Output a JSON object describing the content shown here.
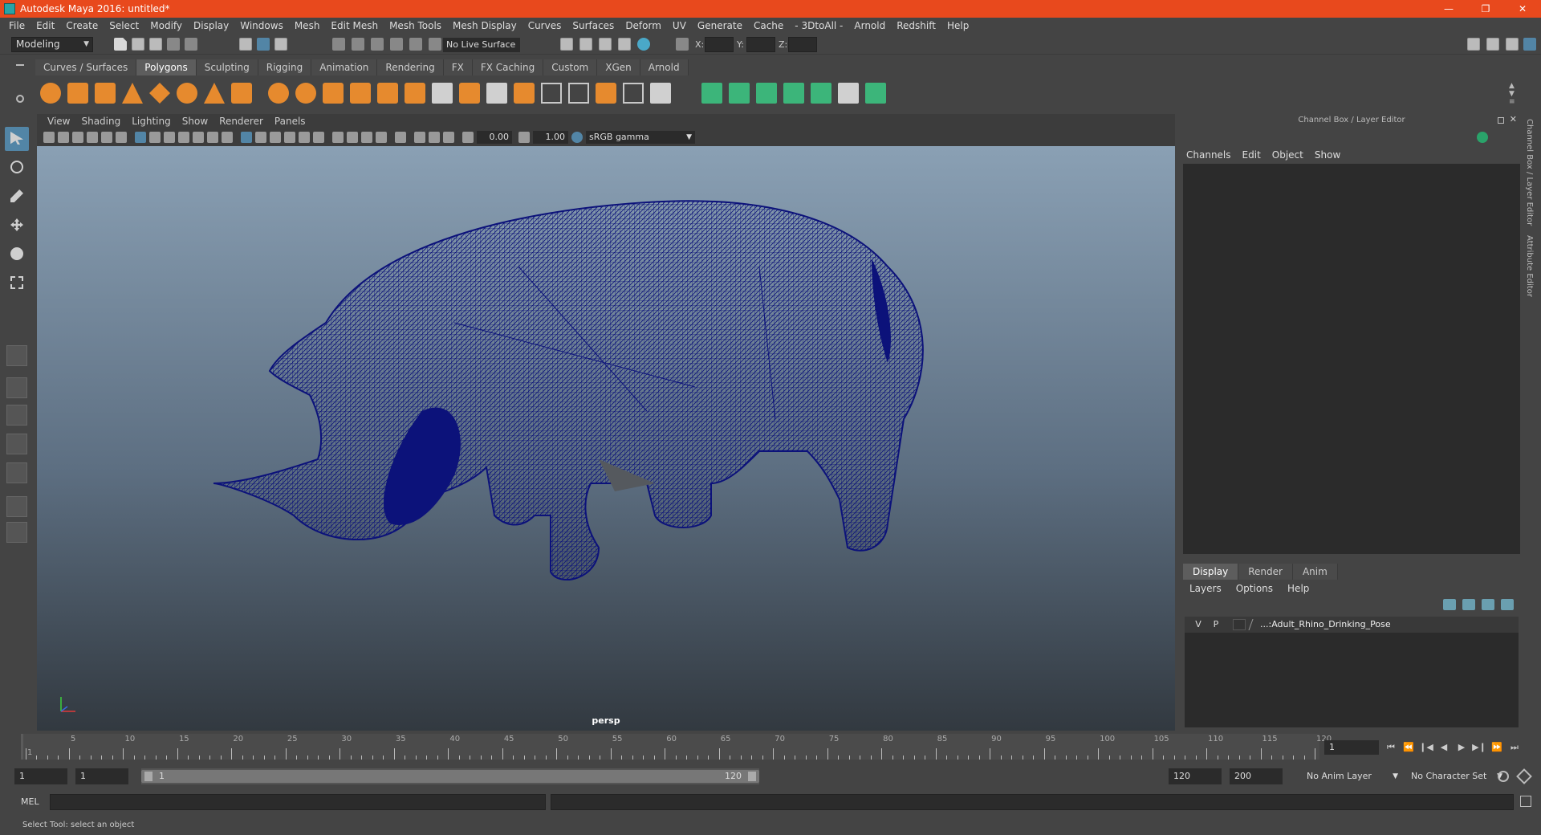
{
  "window": {
    "title": "Autodesk Maya 2016: untitled*",
    "controls": [
      "—",
      "❐",
      "✕"
    ]
  },
  "menubar": [
    "File",
    "Edit",
    "Create",
    "Select",
    "Modify",
    "Display",
    "Windows",
    "Mesh",
    "Edit Mesh",
    "Mesh Tools",
    "Mesh Display",
    "Curves",
    "Surfaces",
    "Deform",
    "UV",
    "Generate",
    "Cache",
    "- 3DtoAll -",
    "Arnold",
    "Redshift",
    "Help"
  ],
  "statusline": {
    "mode": "Modeling",
    "live_surface": "No Live Surface",
    "x_label": "X:",
    "y_label": "Y:",
    "z_label": "Z:"
  },
  "shelf": {
    "tabs": [
      "Curves / Surfaces",
      "Polygons",
      "Sculpting",
      "Rigging",
      "Animation",
      "Rendering",
      "FX",
      "FX Caching",
      "Custom",
      "XGen",
      "Arnold"
    ],
    "active_tab": "Polygons"
  },
  "panel": {
    "menu": [
      "View",
      "Shading",
      "Lighting",
      "Show",
      "Renderer",
      "Panels"
    ],
    "exposure": "0.00",
    "gamma": "1.00",
    "color_space": "sRGB gamma",
    "camera": "persp"
  },
  "channel_box": {
    "title": "Channel Box / Layer Editor",
    "menu": [
      "Channels",
      "Edit",
      "Object",
      "Show"
    ]
  },
  "layer_editor": {
    "tabs": [
      "Display",
      "Render",
      "Anim"
    ],
    "active_tab": "Display",
    "menu": [
      "Layers",
      "Options",
      "Help"
    ],
    "layers": [
      {
        "v": "V",
        "p": "P",
        "name": "...:Adult_Rhino_Drinking_Pose"
      }
    ]
  },
  "side_tabs": [
    "Channel Box / Layer Editor",
    "Attribute Editor"
  ],
  "timeline": {
    "ticks": [
      1,
      5,
      10,
      15,
      20,
      25,
      30,
      35,
      40,
      45,
      50,
      55,
      60,
      65,
      70,
      75,
      80,
      85,
      90,
      95,
      100,
      105,
      110,
      115,
      120
    ],
    "min": 1,
    "max": 120,
    "current_frame": "1"
  },
  "range": {
    "start_field": "1",
    "playback_start": "1",
    "slider_start": "1",
    "slider_end": "120",
    "playback_end": "120",
    "end_field": "200",
    "anim_layer": "No Anim Layer",
    "character_set": "No Character Set"
  },
  "cmdline": {
    "label": "MEL"
  },
  "helpline": {
    "text": "Select Tool: select an object"
  },
  "colors": {
    "titlebar": "#e8491d",
    "wireframe": "#0c127a",
    "accent": "#5285a6"
  }
}
